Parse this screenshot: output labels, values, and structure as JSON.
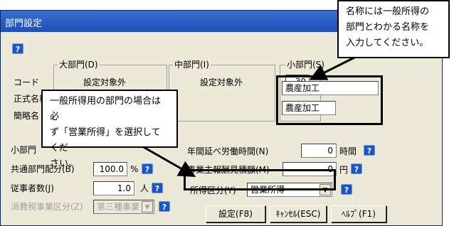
{
  "window": {
    "title": "部門設定"
  },
  "groups": {
    "dai": {
      "label": "大部門(D)",
      "value": "設定対象外"
    },
    "chu": {
      "label": "中部門(I)",
      "value": "設定対象外"
    },
    "sho": {
      "label": "小部門(S)",
      "code": "30",
      "name_formal": "農産加工",
      "name_short": "農産加工"
    }
  },
  "row_labels": {
    "code": "コード",
    "formal": "正式名称",
    "short": "簡略名"
  },
  "fields": {
    "sho_label": "小部門",
    "common_ratio": {
      "label": "共通部門配分(B)",
      "value": "100.0",
      "unit": "%"
    },
    "employees": {
      "label": "従事者数(J)",
      "value": "1.0",
      "unit": "人"
    },
    "tax_class": {
      "label": "消費税事業区分(Z)",
      "value": "第三種事業"
    },
    "hours": {
      "label": "年間延べ労働時間(N)",
      "value": "0",
      "unit": "時間"
    },
    "owner_pay": {
      "label": "事業主報酬見積額(M)",
      "value": "0",
      "unit": "円"
    },
    "income_class": {
      "label": "所得区分(Y)",
      "value": "営業所得"
    }
  },
  "buttons": {
    "settings": "設定(F8)",
    "cancel": "ｷｬﾝｾﾙ(ESC)",
    "help": "ﾍﾙﾌﾟ(F1)"
  },
  "callouts": {
    "top": [
      "名称には一般所得の",
      "部門とわかる名称を",
      "入力してください。"
    ],
    "middle": [
      "一般所得用の部門の場合は必",
      "ず「営業所得」を選択してくだ",
      "さい。"
    ]
  },
  "help_glyph": "?"
}
